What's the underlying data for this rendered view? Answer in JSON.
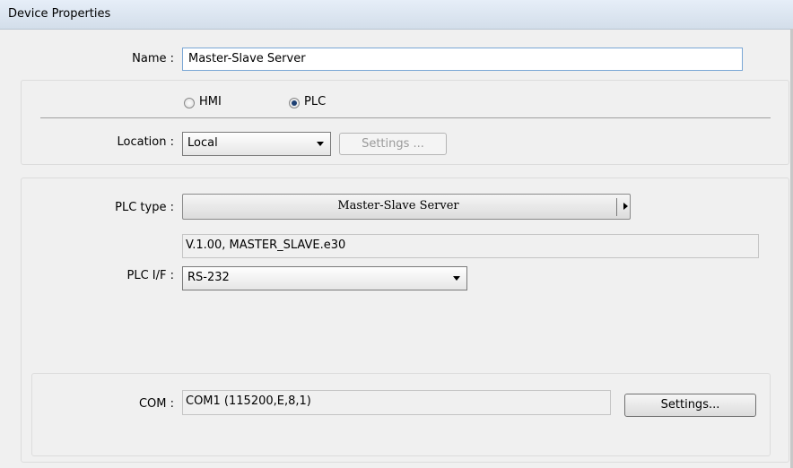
{
  "window": {
    "title": "Device Properties"
  },
  "name": {
    "label": "Name :",
    "value": "Master-Slave Server"
  },
  "device_type": {
    "options": [
      {
        "label": "HMI",
        "selected": false
      },
      {
        "label": "PLC",
        "selected": true
      }
    ]
  },
  "location": {
    "label": "Location :",
    "value": "Local",
    "settings_label": "Settings ..."
  },
  "plc_type": {
    "label": "PLC type :",
    "value": "Master-Slave Server",
    "version": "V.1.00, MASTER_SLAVE.e30"
  },
  "plc_if": {
    "label": "PLC I/F :",
    "value": "RS-232"
  },
  "com": {
    "label": "COM :",
    "value": "COM1 (115200,E,8,1)",
    "settings_label": "Settings..."
  }
}
